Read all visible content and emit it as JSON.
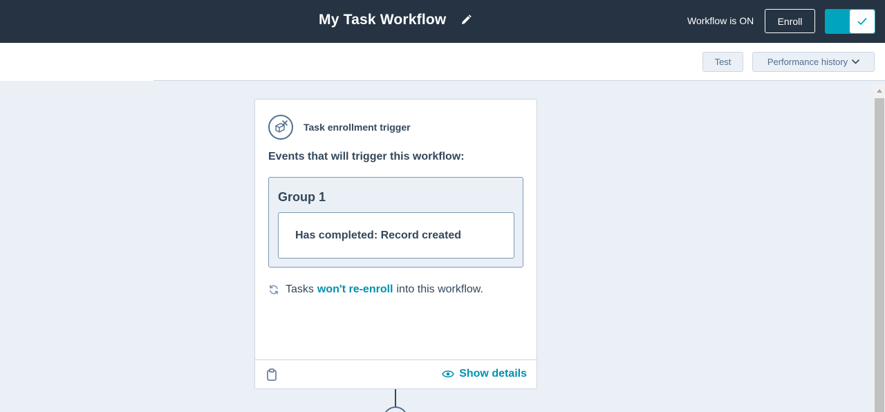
{
  "header": {
    "title": "My Task Workflow",
    "edit_icon": "pencil-icon",
    "status_text": "Workflow is ON",
    "enroll_label": "Enroll",
    "toggle_on": true,
    "toggle_icon": "check-icon"
  },
  "subbar": {
    "test_label": "Test",
    "performance_label": "Performance history",
    "performance_icon": "chevron-down-icon"
  },
  "card": {
    "trigger_icon": "task-trigger-icon",
    "trigger_label": "Task enrollment trigger",
    "events_heading": "Events that will trigger this workflow:",
    "group_title": "Group 1",
    "condition": "Has completed: Record created",
    "reenroll_prefix": "Tasks",
    "reenroll_link": "won't re-enroll",
    "reenroll_suffix": "into this workflow.",
    "show_details_label": "Show details"
  },
  "colors": {
    "topbar": "#253342",
    "accent": "#00a4bd",
    "link": "#0091ae",
    "canvas": "#eaf0f6",
    "text": "#33475b"
  }
}
